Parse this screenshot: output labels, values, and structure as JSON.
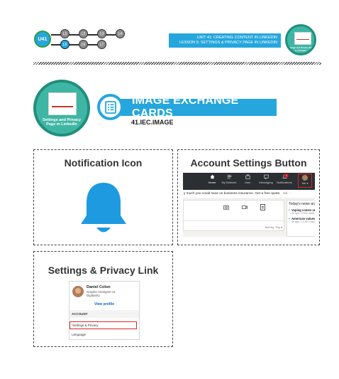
{
  "header": {
    "unit_badge": "U41",
    "lessons": [
      "L1",
      "L2",
      "L3",
      "L4",
      "L5",
      "L6",
      "L7"
    ],
    "active_lesson": "L5",
    "unit_line": "UNIT 41:  CREATING CONTENT IN LINKEDIN",
    "lesson_line": "LESSON 5: SETTINGS & PRIVACY PAGE IN LINKEDIN",
    "thumb_caption": "Settings and Privacy Page in LinkedIn"
  },
  "section": {
    "thumb_caption": "Settings and Privacy Page in LinkedIn",
    "title": "IMAGE EXCHANGE CARDS",
    "code": "41.IEC.IMAGE"
  },
  "cards": {
    "notification": {
      "title": "Notification Icon"
    },
    "account_settings": {
      "title": "Account Settings Button",
      "nav_items": [
        "Home",
        "My Network",
        "Jobs",
        "Messaging",
        "Notifications",
        "Me ▾"
      ],
      "notif_count": "1",
      "ad_text": "y much you could save on business insurance. Get a free quote.",
      "ad_label": "Ad  ···",
      "sort_text": "Sort by: Top ▾",
      "news_header": "Today's news and v",
      "news_items": [
        {
          "headline": "Vaping comes unc",
          "meta": "4h ago • 3,914 reade"
        },
        {
          "headline": "American values c",
          "meta": "4h ago • 13,947 read"
        }
      ]
    },
    "settings_privacy": {
      "title": "Settings & Privacy Link",
      "profile_name": "Daniel Colon",
      "profile_role_1": "Graphic Designer at",
      "profile_role_2": "Digitastry",
      "view_profile": "View profile",
      "account_label": "ACCOUNT",
      "settings_link": "Settings & Privacy",
      "language_link": "Language"
    }
  },
  "colors": {
    "accent_blue": "#25a6dd",
    "teal": "#3fb6a4",
    "bell": "#1e9be0",
    "highlight_red": "#d62828"
  }
}
